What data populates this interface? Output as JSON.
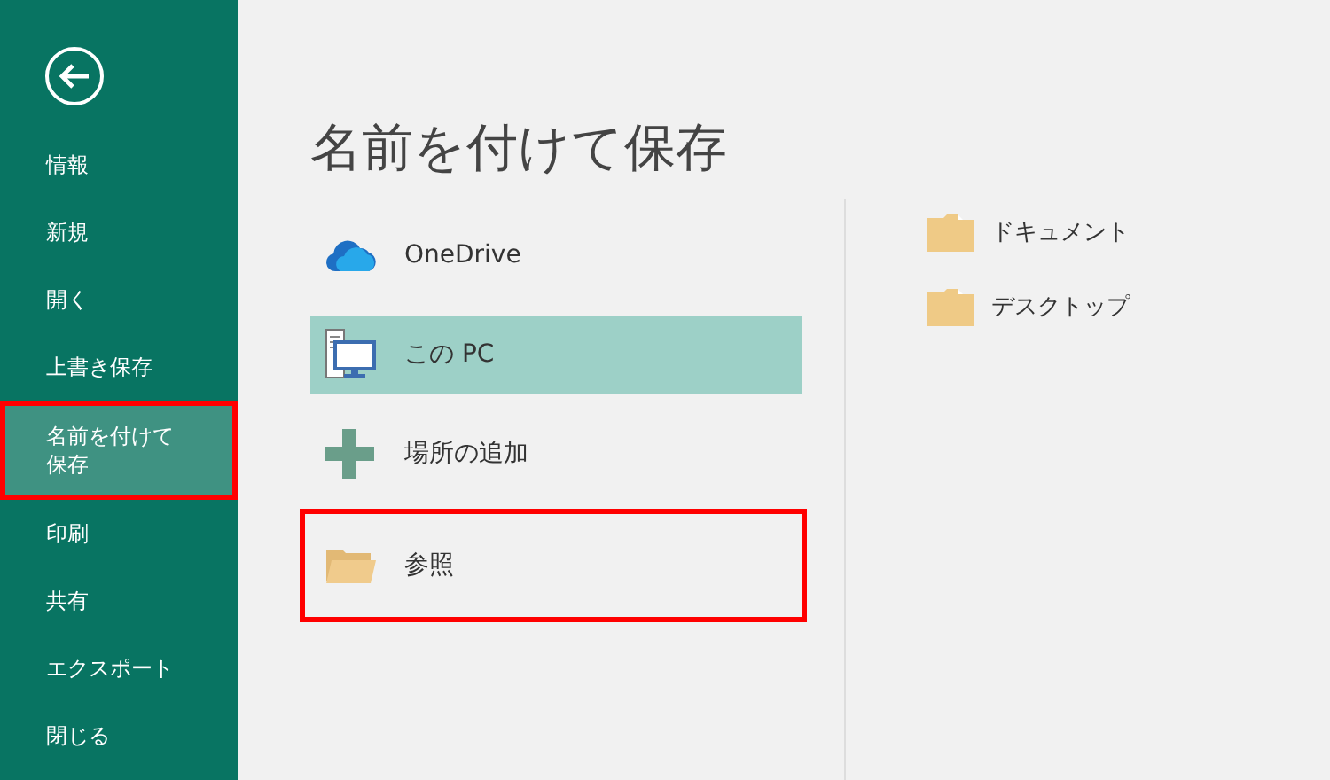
{
  "sidebar": {
    "items": [
      {
        "label": "情報",
        "selected": false,
        "highlighted": false
      },
      {
        "label": "新規",
        "selected": false,
        "highlighted": false
      },
      {
        "label": "開く",
        "selected": false,
        "highlighted": false
      },
      {
        "label": "上書き保存",
        "selected": false,
        "highlighted": false
      },
      {
        "label": "名前を付けて保存",
        "selected": true,
        "highlighted": true
      },
      {
        "label": "印刷",
        "selected": false,
        "highlighted": false
      },
      {
        "label": "共有",
        "selected": false,
        "highlighted": false
      },
      {
        "label": "エクスポート",
        "selected": false,
        "highlighted": false
      },
      {
        "label": "閉じる",
        "selected": false,
        "highlighted": false
      }
    ]
  },
  "title": "名前を付けて保存",
  "locations": [
    {
      "kind": "cloud",
      "label": "OneDrive",
      "selected": false,
      "highlighted": false
    },
    {
      "kind": "pc",
      "label": "この PC",
      "selected": true,
      "highlighted": false
    },
    {
      "kind": "add",
      "label": "場所の追加",
      "selected": false,
      "highlighted": false
    },
    {
      "kind": "browse",
      "label": "参照",
      "selected": false,
      "highlighted": true
    }
  ],
  "folders": [
    {
      "label": "ドキュメント"
    },
    {
      "label": "デスクトップ"
    }
  ]
}
